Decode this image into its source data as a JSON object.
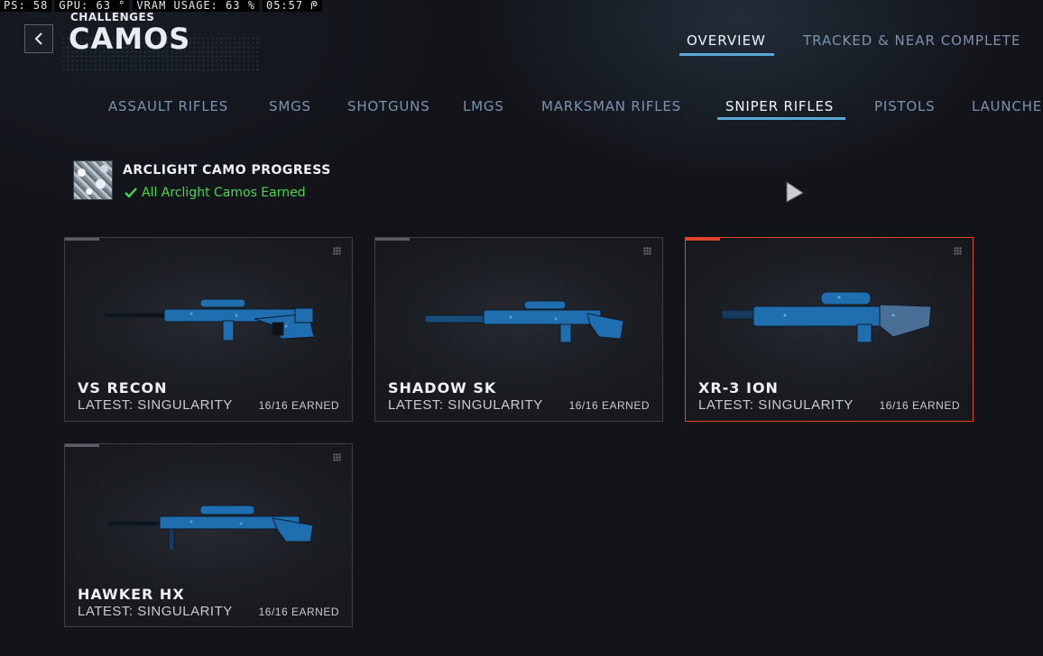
{
  "perf_overlay": {
    "fps": "PS:  58",
    "gpu": "GPU: 63 °",
    "vram": "VRAM USAGE: 63 %",
    "time": "05:57 ᖘ"
  },
  "header": {
    "breadcrumb": "CHALLENGES",
    "title": "CAMOS",
    "tabs": [
      {
        "label": "OVERVIEW",
        "active": true
      },
      {
        "label": "TRACKED & NEAR COMPLETE",
        "active": false
      }
    ]
  },
  "categories": [
    {
      "label": "ASSAULT RIFLES",
      "active": false
    },
    {
      "label": "SMGS",
      "active": false
    },
    {
      "label": "SHOTGUNS",
      "active": false
    },
    {
      "label": "LMGS",
      "active": false
    },
    {
      "label": "MARKSMAN RIFLES",
      "active": false
    },
    {
      "label": "SNIPER RIFLES",
      "active": true
    },
    {
      "label": "PISTOLS",
      "active": false
    },
    {
      "label": "LAUNCHERS",
      "active": false
    }
  ],
  "progress": {
    "title": "ARCLIGHT CAMO PROGRESS",
    "status": "All Arclight Camos Earned"
  },
  "weapons": [
    {
      "name": "VS RECON",
      "latest": "LATEST: SINGULARITY",
      "earned": "16/16 EARNED",
      "selected": false
    },
    {
      "name": "SHADOW SK",
      "latest": "LATEST: SINGULARITY",
      "earned": "16/16 EARNED",
      "selected": false
    },
    {
      "name": "XR-3 ION",
      "latest": "LATEST: SINGULARITY",
      "earned": "16/16 EARNED",
      "selected": true
    },
    {
      "name": "HAWKER HX",
      "latest": "LATEST: SINGULARITY",
      "earned": "16/16 EARNED",
      "selected": false
    }
  ],
  "colors": {
    "accent_tab": "#59a8d8",
    "selected_border": "#e0452b",
    "success": "#49d84a",
    "camo_blue": "#1f6fb0"
  }
}
